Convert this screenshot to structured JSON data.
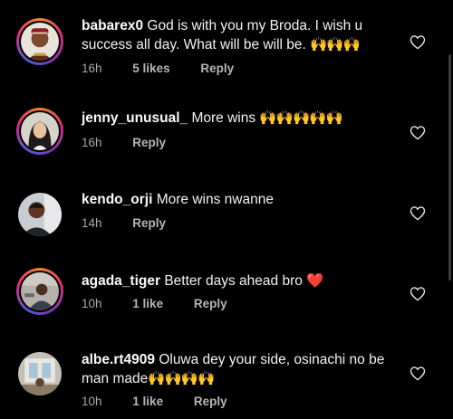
{
  "comments": [
    {
      "username": "babarex0",
      "text": "God is with you my Broda.  I wish u success all day.  What will be will be.",
      "emoji": "🙌🙌🙌",
      "time": "16h",
      "likes": "5 likes",
      "reply": "Reply"
    },
    {
      "username": "jenny_unusual_",
      "text": "More wins",
      "emoji": "🙌🙌🙌🙌🙌",
      "time": "16h",
      "likes": "",
      "reply": "Reply"
    },
    {
      "username": "kendo_orji",
      "text": "More wins nwanne",
      "emoji": "",
      "time": "14h",
      "likes": "",
      "reply": "Reply"
    },
    {
      "username": "agada_tiger",
      "text": "Better days ahead bro",
      "emoji": "❤️",
      "time": "10h",
      "likes": "1 like",
      "reply": "Reply"
    },
    {
      "username": "albe.rt4909",
      "text": "Oluwa dey your side, osinachi no be man made",
      "emoji": "🙌🙌🙌🙌",
      "time": "10h",
      "likes": "1 like",
      "reply": "Reply"
    }
  ],
  "icons": {
    "like": "heart-outline-icon"
  },
  "colors": {
    "background": "#000000",
    "text": "#f5f5f5",
    "meta": "#a8a8a8",
    "heart": "#e0233a"
  }
}
